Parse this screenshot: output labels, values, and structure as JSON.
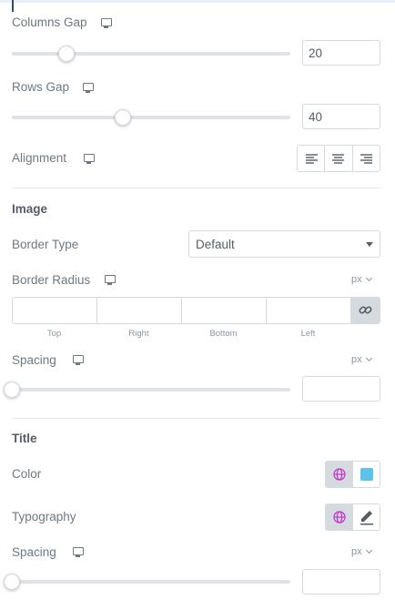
{
  "columns_gap": {
    "label": "Columns Gap",
    "value": "20",
    "slider_fraction": 0.2
  },
  "rows_gap": {
    "label": "Rows Gap",
    "value": "40",
    "slider_fraction": 0.4
  },
  "alignment": {
    "label": "Alignment",
    "options": [
      "align-left-icon",
      "align-center-icon",
      "align-right-icon"
    ]
  },
  "image": {
    "header": "Image",
    "border_type": {
      "label": "Border Type",
      "value": "Default"
    },
    "border_radius": {
      "label": "Border Radius",
      "unit": "px",
      "fields": [
        {
          "label": "Top",
          "value": ""
        },
        {
          "label": "Right",
          "value": ""
        },
        {
          "label": "Bottom",
          "value": ""
        },
        {
          "label": "Left",
          "value": ""
        }
      ]
    },
    "spacing": {
      "label": "Spacing",
      "unit": "px",
      "value": "",
      "slider_fraction": 0
    }
  },
  "title": {
    "header": "Title",
    "color": {
      "label": "Color",
      "swatch": "#61c0e8"
    },
    "typography": {
      "label": "Typography"
    },
    "spacing": {
      "label": "Spacing",
      "unit": "px",
      "value": "",
      "slider_fraction": 0
    }
  },
  "colors": {
    "globe_icon": "#c33bc7",
    "accent": "#2c4a6e"
  }
}
